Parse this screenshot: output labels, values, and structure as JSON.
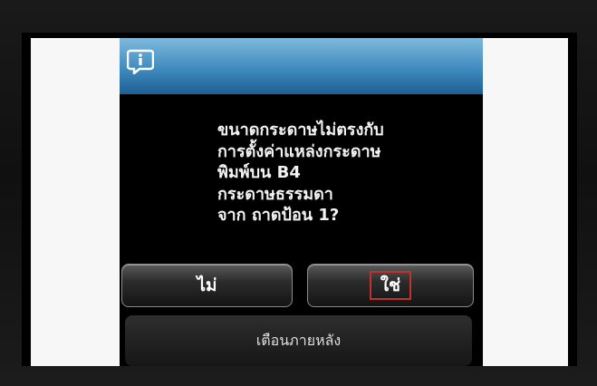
{
  "dialog": {
    "icon": "info-icon",
    "message_lines": [
      "ขนาดกระดาษไม่ตรงกับ",
      "การตั้งค่าแหล่งกระดาษ",
      "พิมพ์บน B4",
      "กระดาษธรรมดา",
      "จาก ถาดป้อน 1?"
    ],
    "no_label": "ไม่",
    "yes_label": "ใช่",
    "later_label": "เตือนภายหลัง"
  },
  "colors": {
    "header_gradient_top": "#7fb9dc",
    "header_gradient_bottom": "#1d5f93",
    "highlight_border": "#c4302b"
  }
}
